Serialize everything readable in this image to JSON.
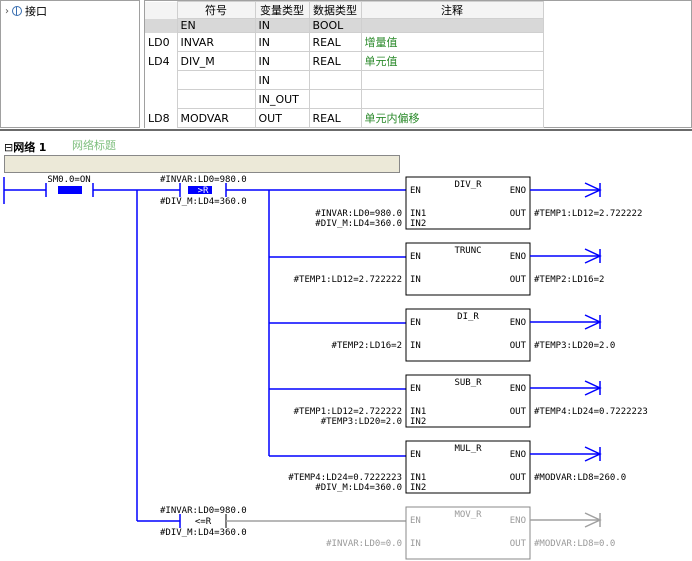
{
  "tree": {
    "expand_glyph": "›",
    "item_label": "接口"
  },
  "interface_table": {
    "headers": [
      "符号",
      "变量类型",
      "数据类型",
      "注释"
    ],
    "rows": [
      {
        "addr": "",
        "symbol": "EN",
        "var_type": "IN",
        "data_type": "BOOL",
        "comment": ""
      },
      {
        "addr": "LD0",
        "symbol": "INVAR",
        "var_type": "IN",
        "data_type": "REAL",
        "comment": "增量值"
      },
      {
        "addr": "LD4",
        "symbol": "DIV_M",
        "var_type": "IN",
        "data_type": "REAL",
        "comment": "单元值"
      },
      {
        "addr": "",
        "symbol": "",
        "var_type": "IN",
        "data_type": "",
        "comment": ""
      },
      {
        "addr": "",
        "symbol": "",
        "var_type": "IN_OUT",
        "data_type": "",
        "comment": ""
      },
      {
        "addr": "LD8",
        "symbol": "MODVAR",
        "var_type": "OUT",
        "data_type": "REAL",
        "comment": "单元内偏移"
      }
    ]
  },
  "network": {
    "label": "网络",
    "number": "1",
    "title": "网络标题",
    "collapse_glyph": "⊟"
  },
  "ladder": {
    "contact_sm": "SM0.0=ON",
    "cmp1": {
      "top": "#INVAR:LD0=980.0",
      "op": ">R",
      "bottom": "#DIV_M:LD4=360.0"
    },
    "cmp2": {
      "top": "#INVAR:LD0=980.0",
      "op": "<=R",
      "bottom": "#DIV_M:LD4=360.0"
    },
    "boxes": [
      {
        "title": "DIV_R",
        "in1_label": "IN1",
        "in2_label": "IN2",
        "in1": "#INVAR:LD0=980.0",
        "in2": "#DIV_M:LD4=360.0",
        "out": "#TEMP1:LD12=2.722222"
      },
      {
        "title": "TRUNC",
        "in1_label": "IN",
        "in1": "#TEMP1:LD12=2.722222",
        "out": "#TEMP2:LD16=2"
      },
      {
        "title": "DI_R",
        "in1_label": "IN",
        "in1": "#TEMP2:LD16=2",
        "out": "#TEMP3:LD20=2.0"
      },
      {
        "title": "SUB_R",
        "in1_label": "IN1",
        "in2_label": "IN2",
        "in1": "#TEMP1:LD12=2.722222",
        "in2": "#TEMP3:LD20=2.0",
        "out": "#TEMP4:LD24=0.7222223"
      },
      {
        "title": "MUL_R",
        "in1_label": "IN1",
        "in2_label": "IN2",
        "in1": "#TEMP4:LD24=0.7222223",
        "in2": "#DIV_M:LD4=360.0",
        "out": "#MODVAR:LD8=260.0"
      },
      {
        "title": "MOV_R",
        "in1_label": "IN",
        "in1": "#INVAR:LD0=0.0",
        "out": "#MODVAR:LD8=0.0"
      }
    ],
    "pin_en": "EN",
    "pin_eno": "ENO",
    "pin_out": "OUT",
    "colors": {
      "active": "#0000ff",
      "inactive": "#a0a0a0",
      "text_dim": "#9a9a9a"
    }
  }
}
